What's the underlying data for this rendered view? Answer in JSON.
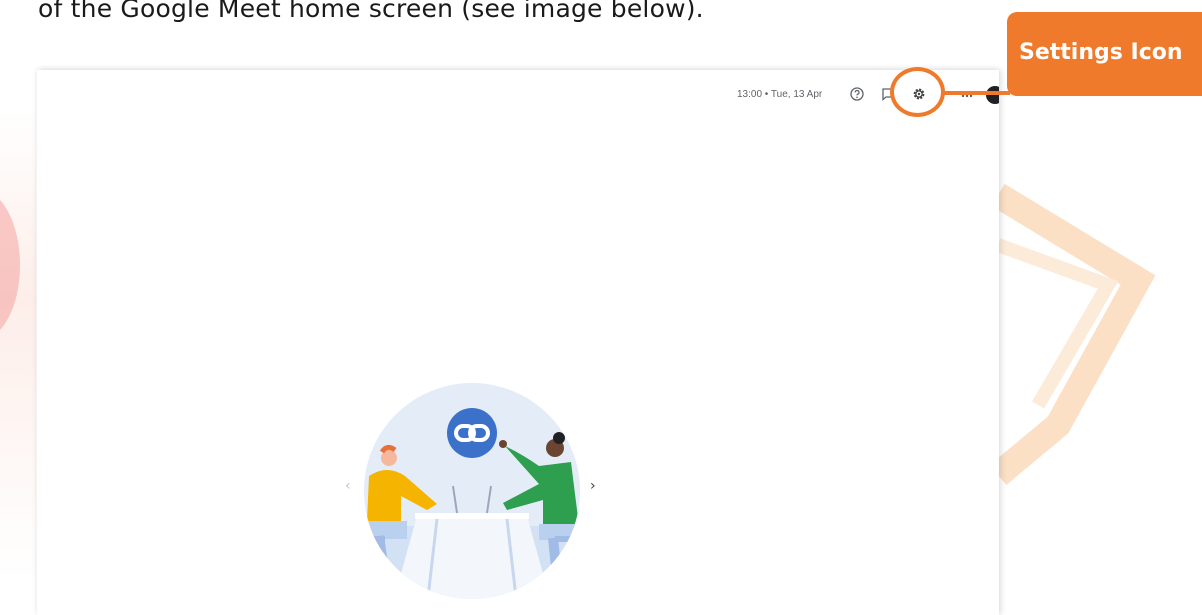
{
  "caption": "of the Google Meet home screen (see image below).",
  "meet": {
    "time": "13:00 • Tue, 13 Apr",
    "icons": {
      "help": "help-circle-icon",
      "feedback": "feedback-icon",
      "settings": "settings-gear-icon",
      "apps": "apps-grid-icon",
      "account": "account-avatar"
    },
    "carousel": {
      "prev": "‹",
      "next": "›"
    }
  },
  "annotation": {
    "label": "Settings Icon",
    "color": "#f07a2b"
  },
  "colors": {
    "meet_link_badge": "#3c71c9",
    "person_left_shirt": "#f5b400",
    "person_right_shirt": "#2e9e4f",
    "illustration_bg": "#dfe8f6"
  }
}
